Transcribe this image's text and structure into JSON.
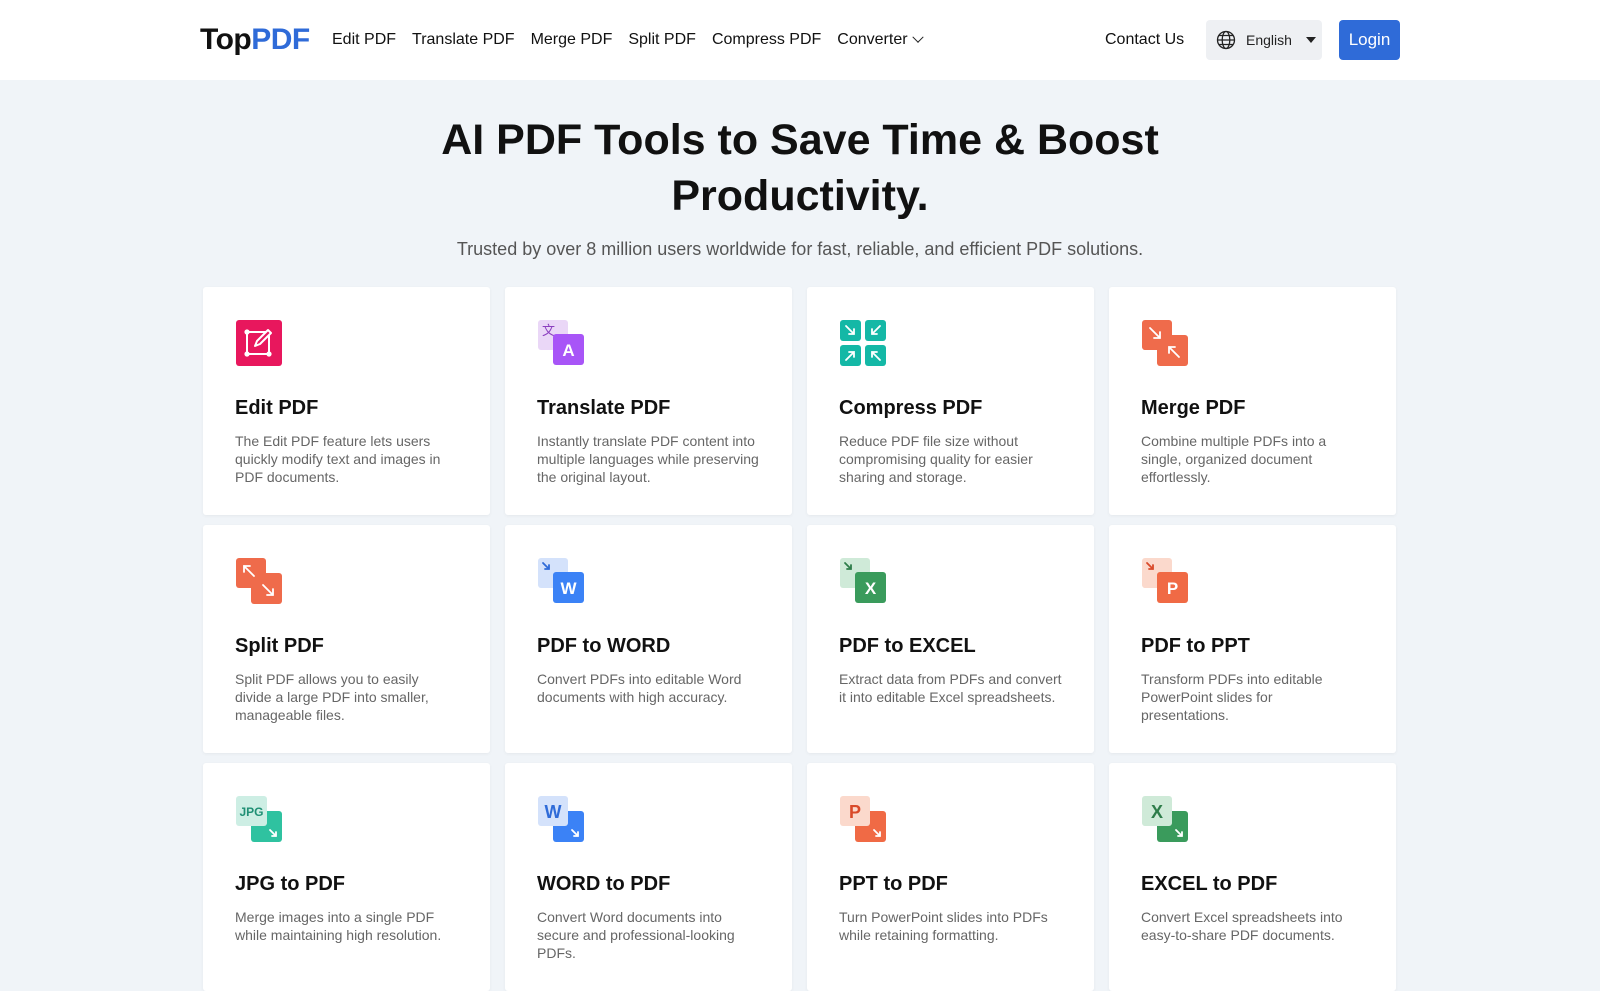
{
  "header": {
    "logo": {
      "part1": "Top",
      "part2": "PDF"
    },
    "nav": [
      "Edit PDF",
      "Translate PDF",
      "Merge PDF",
      "Split PDF",
      "Compress PDF",
      "Converter"
    ],
    "contact": "Contact Us",
    "language": "English",
    "login": "Login"
  },
  "hero": {
    "title": "AI PDF Tools to Save Time & Boost Productivity.",
    "subtitle": "Trusted by over 8 million users worldwide for fast, reliable, and efficient PDF solutions."
  },
  "tools": [
    {
      "title": "Edit PDF",
      "desc": "The Edit PDF feature lets users quickly modify text and images in PDF documents.",
      "icon": "edit-icon",
      "color": "#e8175d"
    },
    {
      "title": "Translate PDF",
      "desc": "Instantly translate PDF content into multiple languages while preserving the original layout.",
      "icon": "translate-icon",
      "color": "#a855f7"
    },
    {
      "title": "Compress PDF",
      "desc": "Reduce PDF file size without compromising quality for easier sharing and storage.",
      "icon": "compress-icon",
      "color": "#14b8a6"
    },
    {
      "title": "Merge PDF",
      "desc": "Combine multiple PDFs into a single, organized document effortlessly.",
      "icon": "merge-icon",
      "color": "#ef6b4b"
    },
    {
      "title": "Split PDF",
      "desc": "Split PDF allows you to easily divide a large PDF into smaller, manageable files.",
      "icon": "split-icon",
      "color": "#ef6b4b"
    },
    {
      "title": "PDF to WORD",
      "desc": "Convert PDFs into editable Word documents with high accuracy.",
      "icon": "pdf-to-word-icon",
      "color": "#3b82f6"
    },
    {
      "title": "PDF to EXCEL",
      "desc": "Extract data from PDFs and convert it into editable Excel spreadsheets.",
      "icon": "pdf-to-excel-icon",
      "color": "#3a9b5c"
    },
    {
      "title": "PDF to PPT",
      "desc": "Transform PDFs into editable PowerPoint slides for presentations.",
      "icon": "pdf-to-ppt-icon",
      "color": "#f06a45"
    },
    {
      "title": "JPG to PDF",
      "desc": "Merge images into a single PDF while maintaining high resolution.",
      "icon": "jpg-to-pdf-icon",
      "color": "#2fc2a0"
    },
    {
      "title": "WORD to PDF",
      "desc": "Convert Word documents into secure and professional-looking PDFs.",
      "icon": "word-to-pdf-icon",
      "color": "#3b82f6"
    },
    {
      "title": "PPT to PDF",
      "desc": "Turn PowerPoint slides into PDFs while retaining formatting.",
      "icon": "ppt-to-pdf-icon",
      "color": "#f06a45"
    },
    {
      "title": "EXCEL to PDF",
      "desc": "Convert Excel spreadsheets into easy-to-share PDF documents.",
      "icon": "excel-to-pdf-icon",
      "color": "#3a9b5c"
    }
  ],
  "icon_glyphs": {
    "translate_back": "文",
    "translate_front": "A",
    "word": "W",
    "excel": "X",
    "ppt": "P",
    "jpg": "JPG"
  }
}
